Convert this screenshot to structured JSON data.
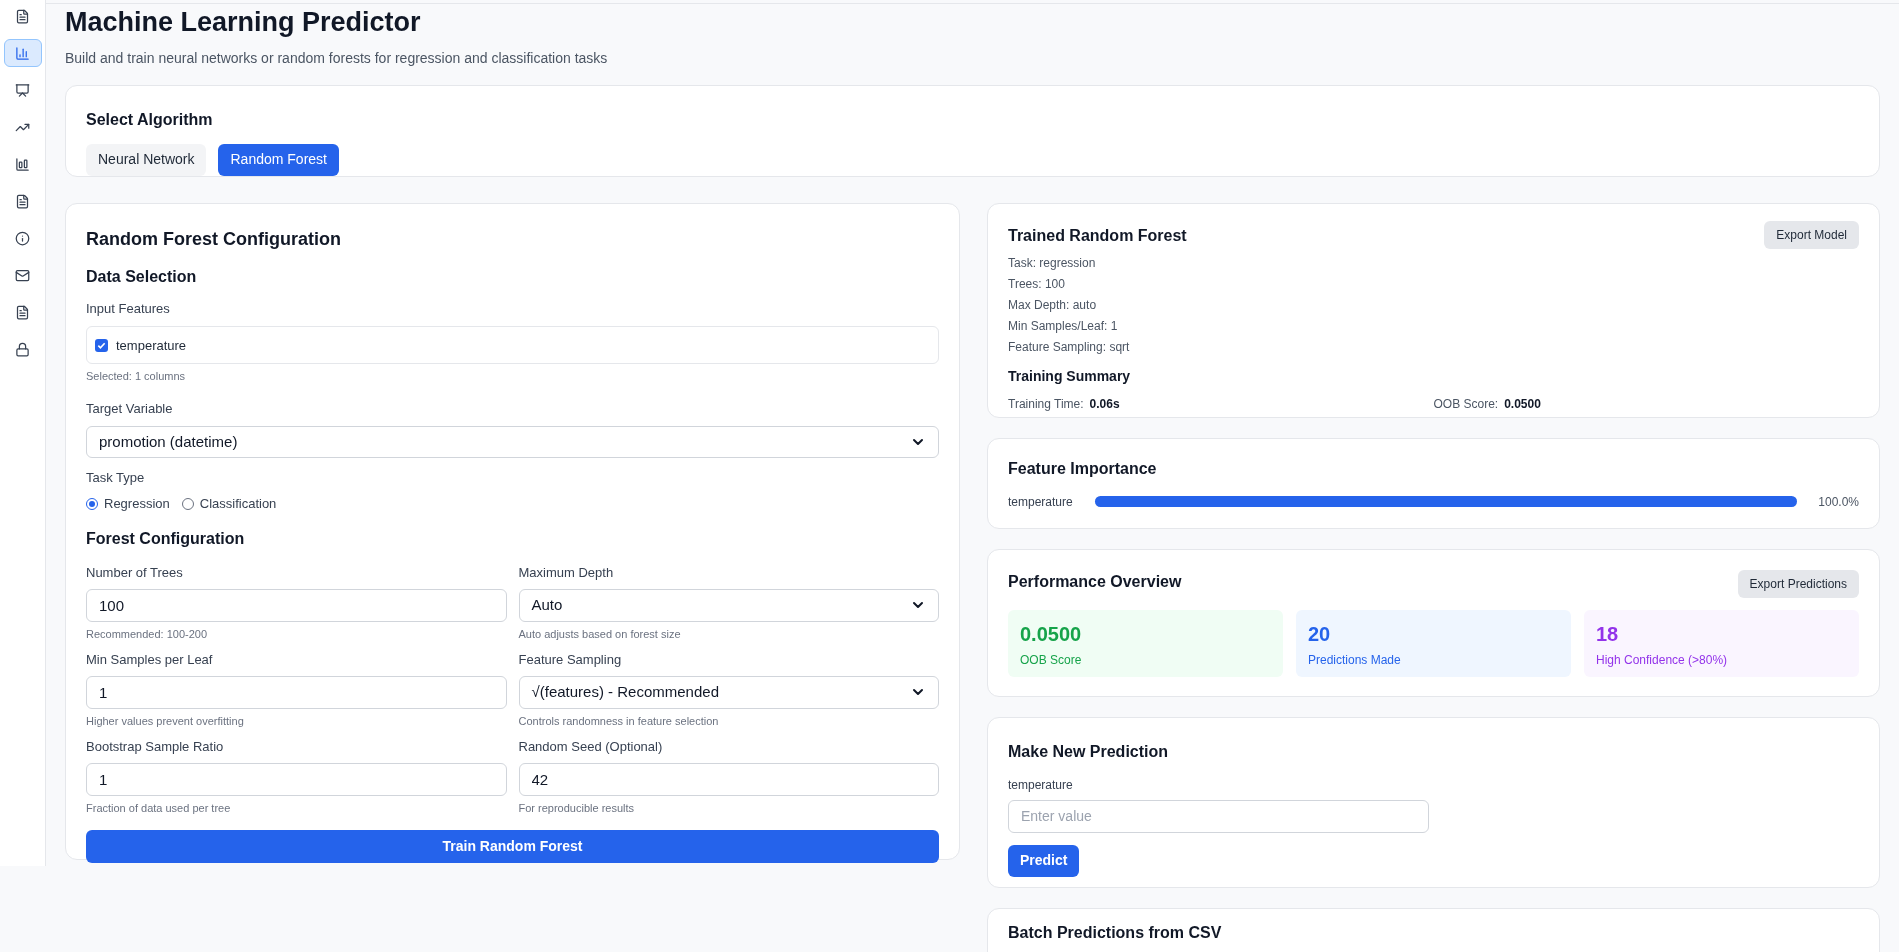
{
  "sidebar": {
    "items": [
      {
        "selected": false
      },
      {
        "selected": true
      },
      {
        "selected": false
      },
      {
        "selected": false
      },
      {
        "selected": false
      },
      {
        "selected": false
      },
      {
        "selected": false
      },
      {
        "selected": false
      },
      {
        "selected": false
      },
      {
        "selected": false
      }
    ]
  },
  "header": {
    "title": "Machine Learning Predictor",
    "subtitle": "Build and train neural networks or random forests for regression and classification tasks"
  },
  "algorithm": {
    "title": "Select Algorithm",
    "options": [
      {
        "label": "Neural Network",
        "selected": false
      },
      {
        "label": "Random Forest",
        "selected": true
      }
    ]
  },
  "config": {
    "title": "Random Forest Configuration",
    "data_section": "Data Selection",
    "input_features_label": "Input Features",
    "features": [
      {
        "label": "temperature",
        "checked": true
      }
    ],
    "selected_note": "Selected: 1 columns",
    "target_label": "Target Variable",
    "target_value": "promotion (datetime)",
    "task_label": "Task Type",
    "task_options": [
      {
        "label": "Regression",
        "selected": true
      },
      {
        "label": "Classification",
        "selected": false
      }
    ],
    "forest_section": "Forest Configuration",
    "fields": [
      {
        "kind": "input",
        "label": "Number of Trees",
        "value": "100",
        "hint": "Recommended: 100-200"
      },
      {
        "kind": "select",
        "label": "Maximum Depth",
        "value": "Auto",
        "hint": "Auto adjusts based on forest size"
      },
      {
        "kind": "input",
        "label": "Min Samples per Leaf",
        "value": "1",
        "hint": "Higher values prevent overfitting"
      },
      {
        "kind": "select",
        "label": "Feature Sampling",
        "value": "√(features) - Recommended",
        "hint": "Controls randomness in feature selection"
      },
      {
        "kind": "input",
        "label": "Bootstrap Sample Ratio",
        "value": "1",
        "hint": "Fraction of data used per tree"
      },
      {
        "kind": "input",
        "label": "Random Seed (Optional)",
        "value": "42",
        "hint": "For reproducible results"
      }
    ],
    "train_button": "Train Random Forest"
  },
  "trained": {
    "title": "Trained Random Forest",
    "export_button": "Export Model",
    "details": [
      "Task: regression",
      "Trees: 100",
      "Max Depth: auto",
      "Min Samples/Leaf: 1",
      "Feature Sampling: sqrt"
    ],
    "summary_title": "Training Summary",
    "summary": [
      {
        "label": "Training Time:",
        "value": "0.06s"
      },
      {
        "label": "OOB Score:",
        "value": "0.0500"
      }
    ]
  },
  "importance": {
    "title": "Feature Importance",
    "rows": [
      {
        "name": "temperature",
        "level": 1.0,
        "reading": "100.0%"
      }
    ]
  },
  "performance": {
    "title": "Performance Overview",
    "export_button": "Export Predictions",
    "stats": [
      {
        "value": "0.0500",
        "label": "OOB Score",
        "color": "#16a34a"
      },
      {
        "value": "20",
        "label": "Predictions Made",
        "color": "#2563eb"
      },
      {
        "value": "18",
        "label": "High Confidence (>80%)",
        "color": "#9333ea"
      }
    ]
  },
  "prediction": {
    "title": "Make New Prediction",
    "field_label": "temperature",
    "placeholder": "Enter value",
    "button": "Predict"
  },
  "batch": {
    "title": "Batch Predictions from CSV"
  }
}
